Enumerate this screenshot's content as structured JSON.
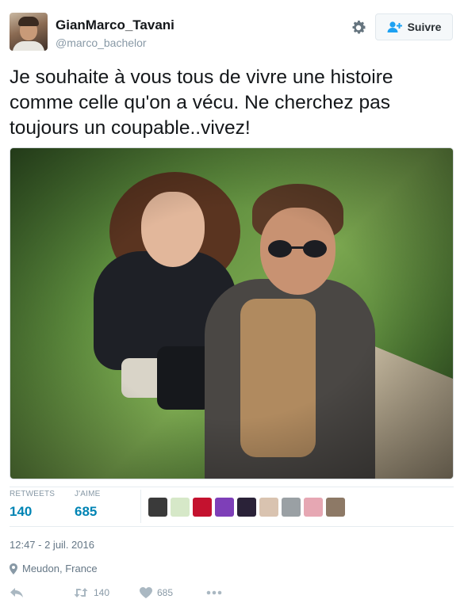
{
  "user": {
    "name": "GianMarco_Tavani",
    "handle": "@marco_bachelor"
  },
  "follow_button": {
    "label": "Suivre"
  },
  "tweet": {
    "text": "Je souhaite à vous tous de vivre une histoire comme celle qu'on a vécu. Ne cherchez pas toujours un coupable..vivez!"
  },
  "stats": {
    "retweets_label": "RETWEETS",
    "retweets_value": "140",
    "likes_label": "J'AIME",
    "likes_value": "685"
  },
  "likers": [
    {
      "color": "#3a3a3a"
    },
    {
      "color": "#d6e8c8"
    },
    {
      "color": "#c4122f"
    },
    {
      "color": "#7e3fb8"
    },
    {
      "color": "#2a2238"
    },
    {
      "color": "#d9c3b0"
    },
    {
      "color": "#9aa0a4"
    },
    {
      "color": "#e6a7b3"
    },
    {
      "color": "#8d7966"
    }
  ],
  "meta": {
    "timestamp": "12:47 - 2 juil. 2016",
    "location": "Meudon, France"
  },
  "actions": {
    "reply_icon": "reply-icon",
    "retweet_count": "140",
    "like_count": "685",
    "more_icon": "more-icon"
  },
  "colors": {
    "link_blue": "#0084b4",
    "muted": "#8899a6",
    "accent": "#1da1f2"
  }
}
